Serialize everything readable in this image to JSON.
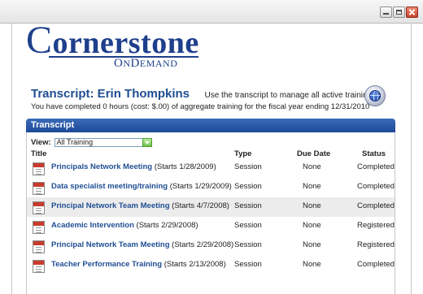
{
  "window": {
    "controls": [
      "minimize-icon",
      "maximize-icon",
      "close-icon"
    ]
  },
  "logo": {
    "big_c": "C",
    "main_rest": "ornerstone",
    "sub_on_cap": "O",
    "sub_on": "N",
    "sub_demand_cap": "D",
    "sub_demand": "EMAND"
  },
  "header": {
    "title": "Transcript: Erin Thompkins",
    "description": "Use the transcript to manage all active training.",
    "summary": "You have completed 0 hours (cost: $.00) of aggregate training for the fiscal year ending 12/31/2010"
  },
  "panel": {
    "title": "Transcript",
    "view_label": "View:",
    "view_value": "All Training",
    "columns": {
      "title": "Title",
      "type": "Type",
      "due": "Due Date",
      "status": "Status"
    },
    "rows": [
      {
        "name": "Principals Network Meeting",
        "starts": "(Starts 1/28/2009)",
        "type": "Session",
        "due": "None",
        "status": "Completed"
      },
      {
        "name": "Data specialist meeting/training",
        "starts": "(Starts 1/29/2009)",
        "type": "Session",
        "due": "None",
        "status": "Completed"
      },
      {
        "name": "Principal Network Team Meeting",
        "starts": "(Starts 4/7/2008)",
        "type": "Session",
        "due": "None",
        "status": "Completed"
      },
      {
        "name": "Academic Intervention",
        "starts": "(Starts 2/29/2008)",
        "type": "Session",
        "due": "None",
        "status": "Registered"
      },
      {
        "name": "Principal Network Team Meeting",
        "starts": "(Starts 2/29/2008)",
        "type": "Session",
        "due": "None",
        "status": "Registered"
      },
      {
        "name": "Teacher Performance Training",
        "starts": "(Starts 2/13/2008)",
        "type": "Session",
        "due": "None",
        "status": "Completed"
      }
    ]
  },
  "colors": {
    "brand_blue": "#1e3f8c",
    "link_blue": "#1f4e93",
    "header_bar": "#2a5aa8",
    "row_highlight": "#ececec"
  }
}
